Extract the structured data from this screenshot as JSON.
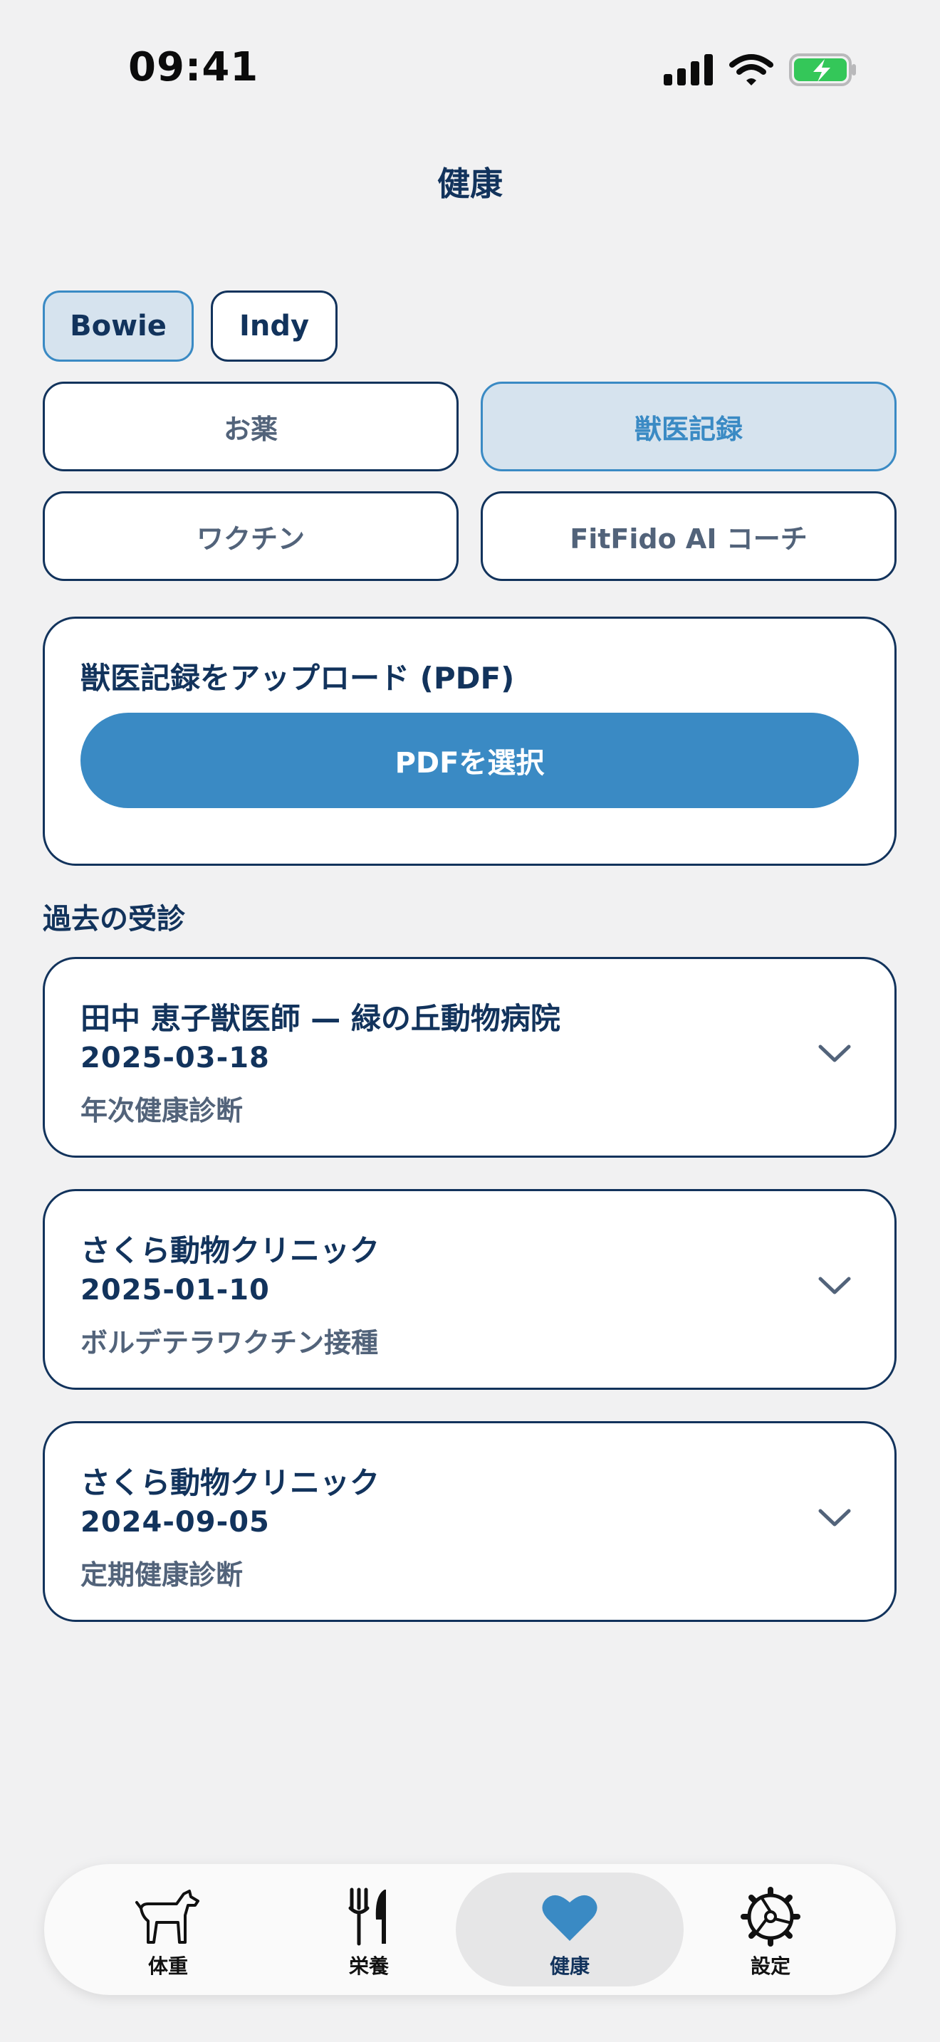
{
  "status_bar": {
    "time": "09:41"
  },
  "header": {
    "title": "健康"
  },
  "pets": [
    {
      "name": "Bowie",
      "selected": true
    },
    {
      "name": "Indy",
      "selected": false
    }
  ],
  "segments": [
    {
      "label": "お薬",
      "selected": false
    },
    {
      "label": "獣医記録",
      "selected": true
    },
    {
      "label": "ワクチン",
      "selected": false
    },
    {
      "label": "FitFido AI コーチ",
      "selected": false
    }
  ],
  "upload": {
    "title": "獣医記録をアップロード (PDF)",
    "button_label": "PDFを選択"
  },
  "past_visits": {
    "title": "過去の受診",
    "items": [
      {
        "vet": "田中 恵子獣医師 — 緑の丘動物病院",
        "date": "2025-03-18",
        "description": "年次健康診断"
      },
      {
        "vet": "さくら動物クリニック",
        "date": "2025-01-10",
        "description": "ボルデテラワクチン接種"
      },
      {
        "vet": "さくら動物クリニック",
        "date": "2024-09-05",
        "description": "定期健康診断"
      }
    ]
  },
  "tab_bar": {
    "items": [
      {
        "label": "体重",
        "icon": "dog-icon",
        "selected": false
      },
      {
        "label": "栄養",
        "icon": "fork-knife-icon",
        "selected": false
      },
      {
        "label": "健康",
        "icon": "heart-icon",
        "selected": true
      },
      {
        "label": "設定",
        "icon": "gear-icon",
        "selected": false
      }
    ]
  },
  "colors": {
    "primary": "#12335c",
    "accent": "#3a8ac4",
    "selected_bg": "#d6e3ee",
    "battery_green": "#34c759"
  }
}
